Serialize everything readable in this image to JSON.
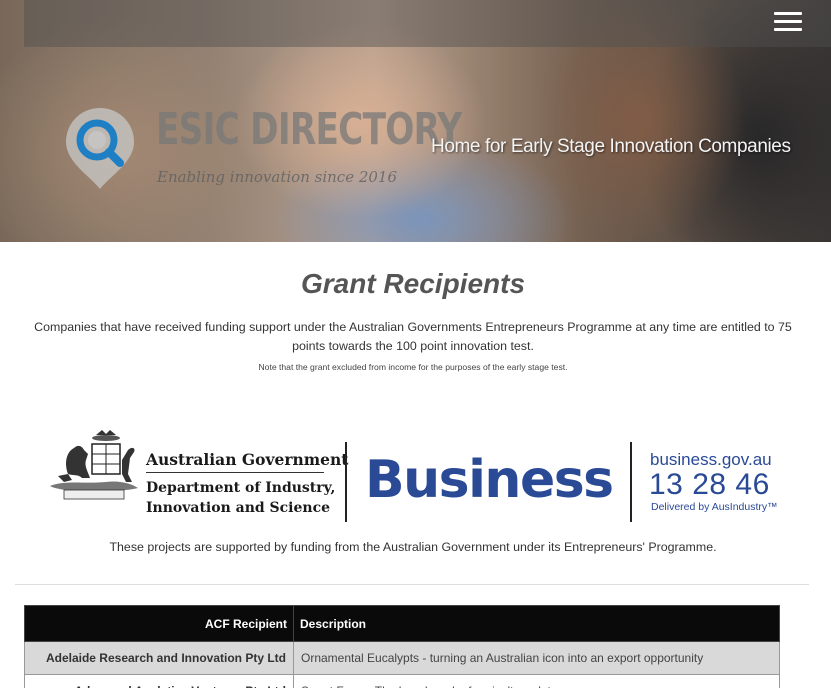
{
  "header": {
    "menu_icon": "hamburger-menu-icon",
    "logo_title": "ESIC DIRECTORY",
    "logo_tagline": "Enabling innovation since 2016",
    "tagline": "Home for Early Stage Innovation Companies"
  },
  "main": {
    "title": "Grant Recipients",
    "intro": "Companies that have received funding support under the Australian Governments Entrepreneurs Programme at any time are entitled to 75 points towards the 100 point innovation test.",
    "note": "Note that the grant excluded from income for the purposes of the early stage test."
  },
  "banner": {
    "gov_line1": "Australian Government",
    "gov_line2": "Department of Industry,",
    "gov_line3": "Innovation and Science",
    "business_word": "Business",
    "business_url": "business.gov.au",
    "business_phone": "13 28 46",
    "business_delivered": "Delivered by AusIndustry™"
  },
  "support_text": "These projects are supported by funding from the Australian Government under its Entrepreneurs' Programme.",
  "table": {
    "headers": [
      "ACF Recipient",
      "Description"
    ],
    "rows": [
      [
        "Adelaide Research and Innovation Pty Ltd",
        "Ornamental Eucalypts - turning an Australian icon into an export opportunity"
      ],
      [
        "Advanced Analytics Ventures Pty Ltd",
        "Smart Farm - The benchmark of agriculture data"
      ]
    ]
  },
  "colors": {
    "business_blue": "#2a4a96",
    "table_header_bg": "#0a0a0a",
    "table_row_shade": "#d9d9d9",
    "title_grey": "#555555"
  }
}
